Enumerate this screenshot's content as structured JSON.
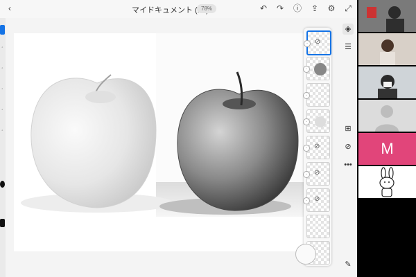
{
  "document": {
    "title": "マイドキュメント (19)",
    "zoom": "78%"
  },
  "video": {
    "tiles": [
      {
        "initial": "M"
      }
    ]
  },
  "colors": {
    "accent": "#1473e6",
    "video_avatar": "#e1457a"
  }
}
